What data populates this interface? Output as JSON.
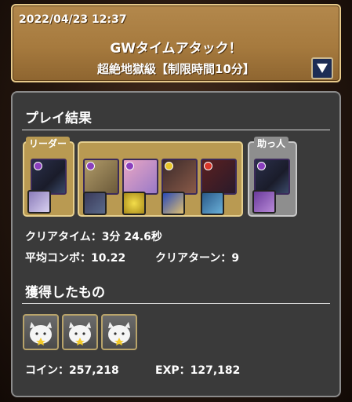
{
  "header": {
    "timestamp": "2022/04/23 12:37",
    "title": "GWタイムアタック！",
    "subtitle": "超絶地獄級【制限時間10分】",
    "dropdown_icon": "triangle-down-icon"
  },
  "results": {
    "section_title": "プレイ結果",
    "leader_label": "リーダー",
    "helper_label": "助っ人",
    "clear_time_label": "クリアタイム：",
    "clear_time_value": "3分 24.6秒",
    "avg_combo_label": "平均コンボ：",
    "avg_combo_value": "10.22",
    "clear_turns_label": "クリアターン：",
    "clear_turns_value": "9"
  },
  "team": {
    "leader": {
      "icon": "dark-dragon-monster-icon",
      "assist_icon": "white-cat-girl-assist-icon"
    },
    "subs": [
      {
        "icon": "blonde-warrior-monster-icon",
        "assist_icon": "dark-beast-assist-icon"
      },
      {
        "icon": "pink-hair-girl-monster-icon",
        "assist_icon": "gold-coin-assist-icon"
      },
      {
        "icon": "pirate-girl-monster-icon",
        "assist_icon": "blue-card-assist-icon"
      },
      {
        "icon": "dark-hair-girl-monster-icon",
        "assist_icon": "blue-dragon-assist-icon"
      }
    ],
    "helper": {
      "icon": "dark-dragon-monster-icon",
      "assist_icon": "purple-dragon-assist-icon"
    }
  },
  "rewards": {
    "section_title": "獲得したもの",
    "items": [
      {
        "icon": "white-cat-star-reward-icon"
      },
      {
        "icon": "white-cat-star-reward-icon"
      },
      {
        "icon": "white-cat-star-reward-icon"
      }
    ],
    "coin_label": "コイン：",
    "coin_value": "257,218",
    "exp_label": "EXP：",
    "exp_value": "127,182"
  },
  "colors": {
    "header_bg": "#a67a3e",
    "panel_bg": "#3a3a3a",
    "leader_frame": "#b99a52",
    "helper_frame": "#8e8e8e",
    "dark_orb": "#8a3fbd",
    "light_orb": "#e8c52a",
    "fire_orb": "#d9362a"
  }
}
